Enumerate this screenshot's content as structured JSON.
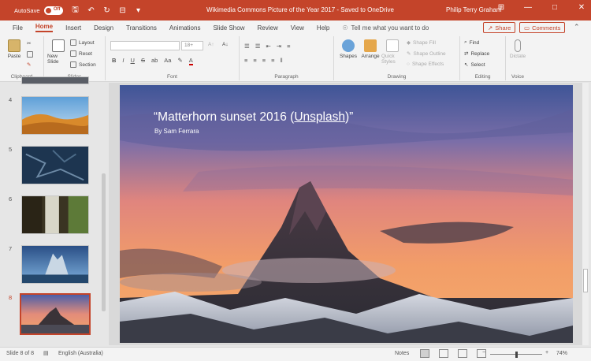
{
  "titlebar": {
    "autosave_label": "AutoSave",
    "autosave_state": "Off",
    "title": "Wikimedia Commons Picture of the Year 2017  -  Saved to OneDrive",
    "user": "Philip Terry Graham"
  },
  "tabs": [
    "File",
    "Home",
    "Insert",
    "Design",
    "Transitions",
    "Animations",
    "Slide Show",
    "Review",
    "View",
    "Help"
  ],
  "tell_me": "Tell me what you want to do",
  "share_label": "Share",
  "comments_label": "Comments",
  "ribbon": {
    "clipboard": {
      "paste": "Paste",
      "label": "Clipboard"
    },
    "slides": {
      "new_slide": "New Slide",
      "layout": "Layout",
      "reset": "Reset",
      "section": "Section",
      "label": "Slides"
    },
    "font": {
      "size": "18+",
      "label": "Font"
    },
    "paragraph": {
      "label": "Paragraph"
    },
    "drawing": {
      "shapes": "Shapes",
      "arrange": "Arrange",
      "quick_styles": "Quick Styles",
      "shape_fill": "Shape Fill",
      "shape_outline": "Shape Outline",
      "shape_effects": "Shape Effects",
      "label": "Drawing"
    },
    "editing": {
      "find": "Find",
      "replace": "Replace",
      "select": "Select",
      "label": "Editing"
    },
    "voice": {
      "dictate": "Dictate",
      "label": "Voice"
    }
  },
  "thumbnails": {
    "numbers": [
      "4",
      "5",
      "6",
      "7",
      "8"
    ],
    "selected": "8"
  },
  "slide": {
    "title_prefix": "“Matterhorn sunset 2016 (",
    "title_link": "Unsplash",
    "title_suffix": ")”",
    "subtitle": "By Sam Ferrara"
  },
  "status": {
    "slide_info": "Slide 8 of 8",
    "language": "English (Australia)",
    "notes": "Notes",
    "zoom": "74%"
  },
  "colors": {
    "accent": "#c4442a"
  }
}
